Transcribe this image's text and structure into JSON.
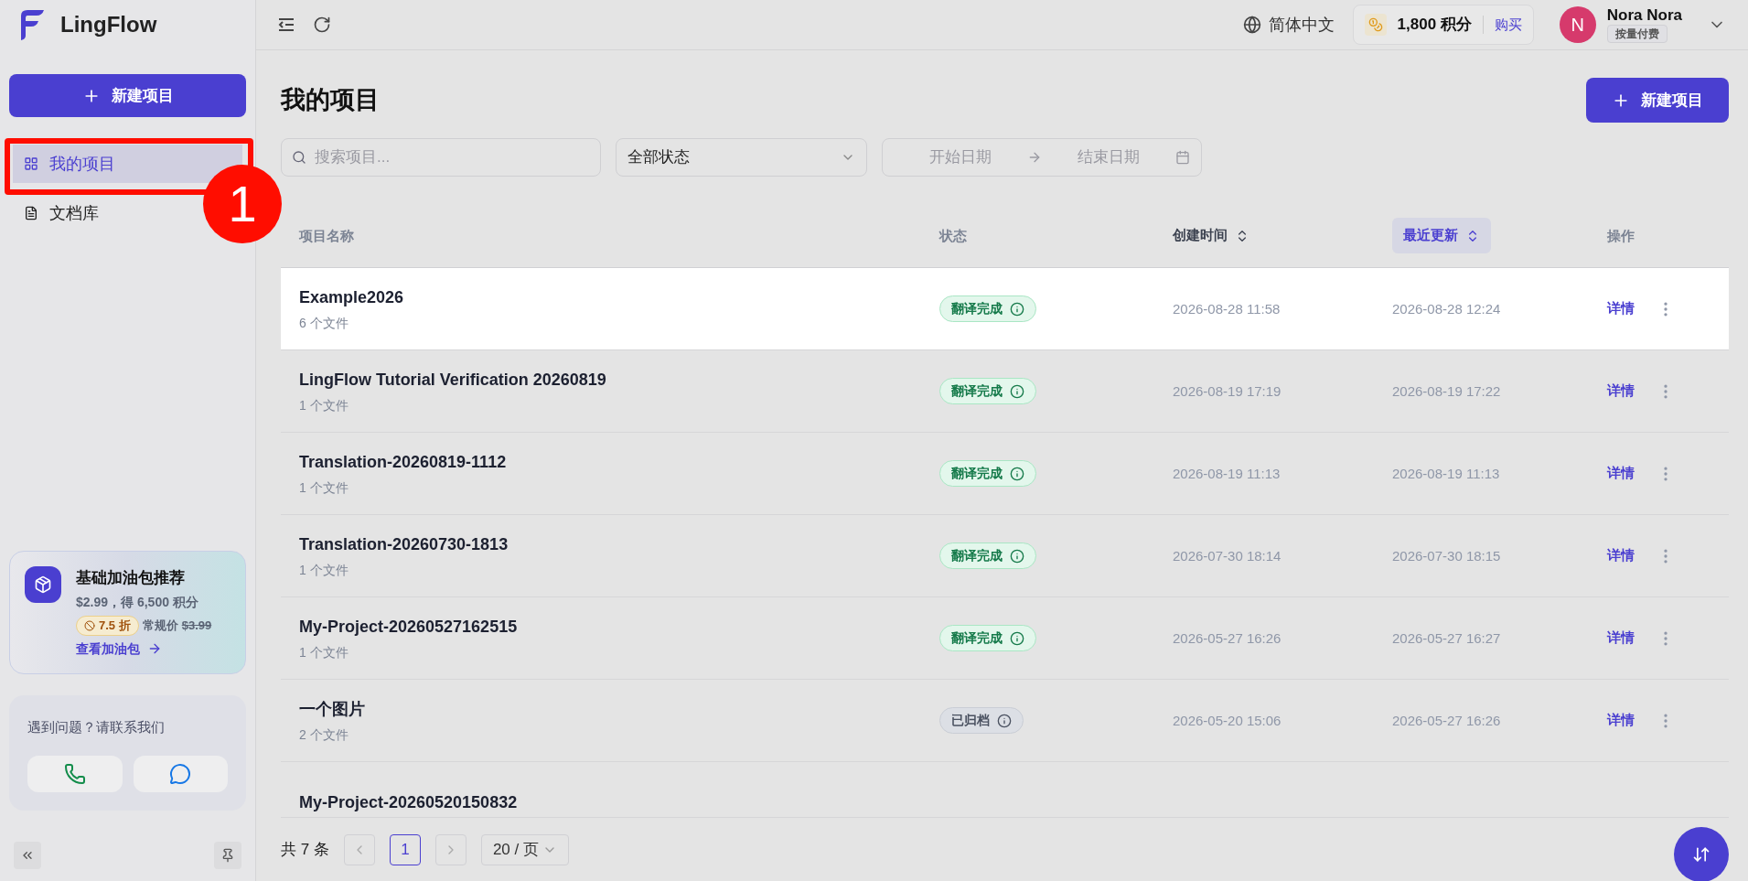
{
  "app": {
    "name": "LingFlow"
  },
  "sidebar": {
    "new_button": "新建项目",
    "nav": [
      {
        "label": "我的项目",
        "kind": "grid",
        "selected": true
      },
      {
        "label": "文档库",
        "kind": "document",
        "selected": false
      }
    ],
    "promo": {
      "title": "基础加油包推荐",
      "subtitle": "$2.99，得 6,500 积分",
      "discount": "7.5 折",
      "regular_label": "常规价",
      "regular_price": "$3.99",
      "link": "查看加油包"
    },
    "help": {
      "text": "遇到问题？请联系我们"
    }
  },
  "annotation": {
    "number": "1"
  },
  "topbar": {
    "language": "简体中文",
    "credits": "1,800 积分",
    "buy": "购买",
    "user": {
      "initial": "N",
      "name": "Nora Nora",
      "plan": "按量付费"
    }
  },
  "page": {
    "title": "我的项目",
    "new_button": "新建项目",
    "search": {
      "placeholder": "搜索项目..."
    },
    "status_filter": "全部状态",
    "date_range": {
      "start_placeholder": "开始日期",
      "end_placeholder": "结束日期"
    }
  },
  "table": {
    "columns": [
      {
        "label": "项目名称",
        "sortable": false,
        "sorted": false
      },
      {
        "label": "状态",
        "sortable": false,
        "sorted": false
      },
      {
        "label": "创建时间",
        "sortable": true,
        "sorted": false
      },
      {
        "label": "最近更新",
        "sortable": true,
        "sorted": true
      },
      {
        "label": "操作",
        "sortable": false,
        "sorted": false
      }
    ],
    "rows": [
      {
        "name": "Example2026",
        "files": "6 个文件",
        "status": {
          "label": "翻译完成",
          "kind": "done"
        },
        "created": "2026-08-28 11:58",
        "updated": "2026-08-28 12:24",
        "action": "详情",
        "highlighted": true
      },
      {
        "name": "LingFlow Tutorial Verification 20260819",
        "files": "1 个文件",
        "status": {
          "label": "翻译完成",
          "kind": "done"
        },
        "created": "2026-08-19 17:19",
        "updated": "2026-08-19 17:22",
        "action": "详情",
        "highlighted": false
      },
      {
        "name": "Translation-20260819-1112",
        "files": "1 个文件",
        "status": {
          "label": "翻译完成",
          "kind": "done"
        },
        "created": "2026-08-19 11:13",
        "updated": "2026-08-19 11:13",
        "action": "详情",
        "highlighted": false
      },
      {
        "name": "Translation-20260730-1813",
        "files": "1 个文件",
        "status": {
          "label": "翻译完成",
          "kind": "done"
        },
        "created": "2026-07-30 18:14",
        "updated": "2026-07-30 18:15",
        "action": "详情",
        "highlighted": false
      },
      {
        "name": "My-Project-20260527162515",
        "files": "1 个文件",
        "status": {
          "label": "翻译完成",
          "kind": "done"
        },
        "created": "2026-05-27 16:26",
        "updated": "2026-05-27 16:27",
        "action": "详情",
        "highlighted": false
      },
      {
        "name": "一个图片",
        "files": "2 个文件",
        "status": {
          "label": "已归档",
          "kind": "archived"
        },
        "created": "2026-05-20 15:06",
        "updated": "2026-05-27 16:26",
        "action": "详情",
        "highlighted": false
      },
      {
        "name": "My-Project-20260520150832",
        "highlighted": false
      }
    ]
  },
  "pagination": {
    "total": "共 7 条",
    "pages": [
      {
        "label": "1",
        "selected": true
      }
    ],
    "page_size": "20 / 页"
  }
}
